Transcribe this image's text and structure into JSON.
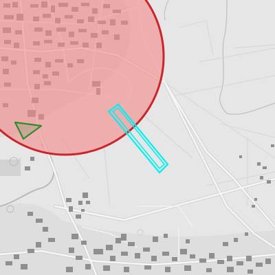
{
  "map": {
    "style": "grayscale-basemap",
    "colors": {
      "background": "#e6e6e6",
      "road_major": "#f7f7f7",
      "road_minor": "#f3f3f3",
      "road_casing": "#c9c9c9",
      "water": "#b9b9b9",
      "building": "#8f8f8f",
      "building_dense": "#9a9a9a",
      "urban_fill": "#dadada",
      "circle_fill": "#f28b8b",
      "circle_stroke": "#c9252b",
      "circle_overlay_fill": "#f4a3a3",
      "runway_stroke": "#00f0f0",
      "triangle_stroke": "#2f8a2f"
    },
    "overlays": [
      {
        "kind": "restricted-zone-circle",
        "color": "#c9252b"
      },
      {
        "kind": "runway-outline",
        "color": "#00f0f0"
      },
      {
        "kind": "triangle-area",
        "color": "#2f8a2f"
      }
    ]
  }
}
